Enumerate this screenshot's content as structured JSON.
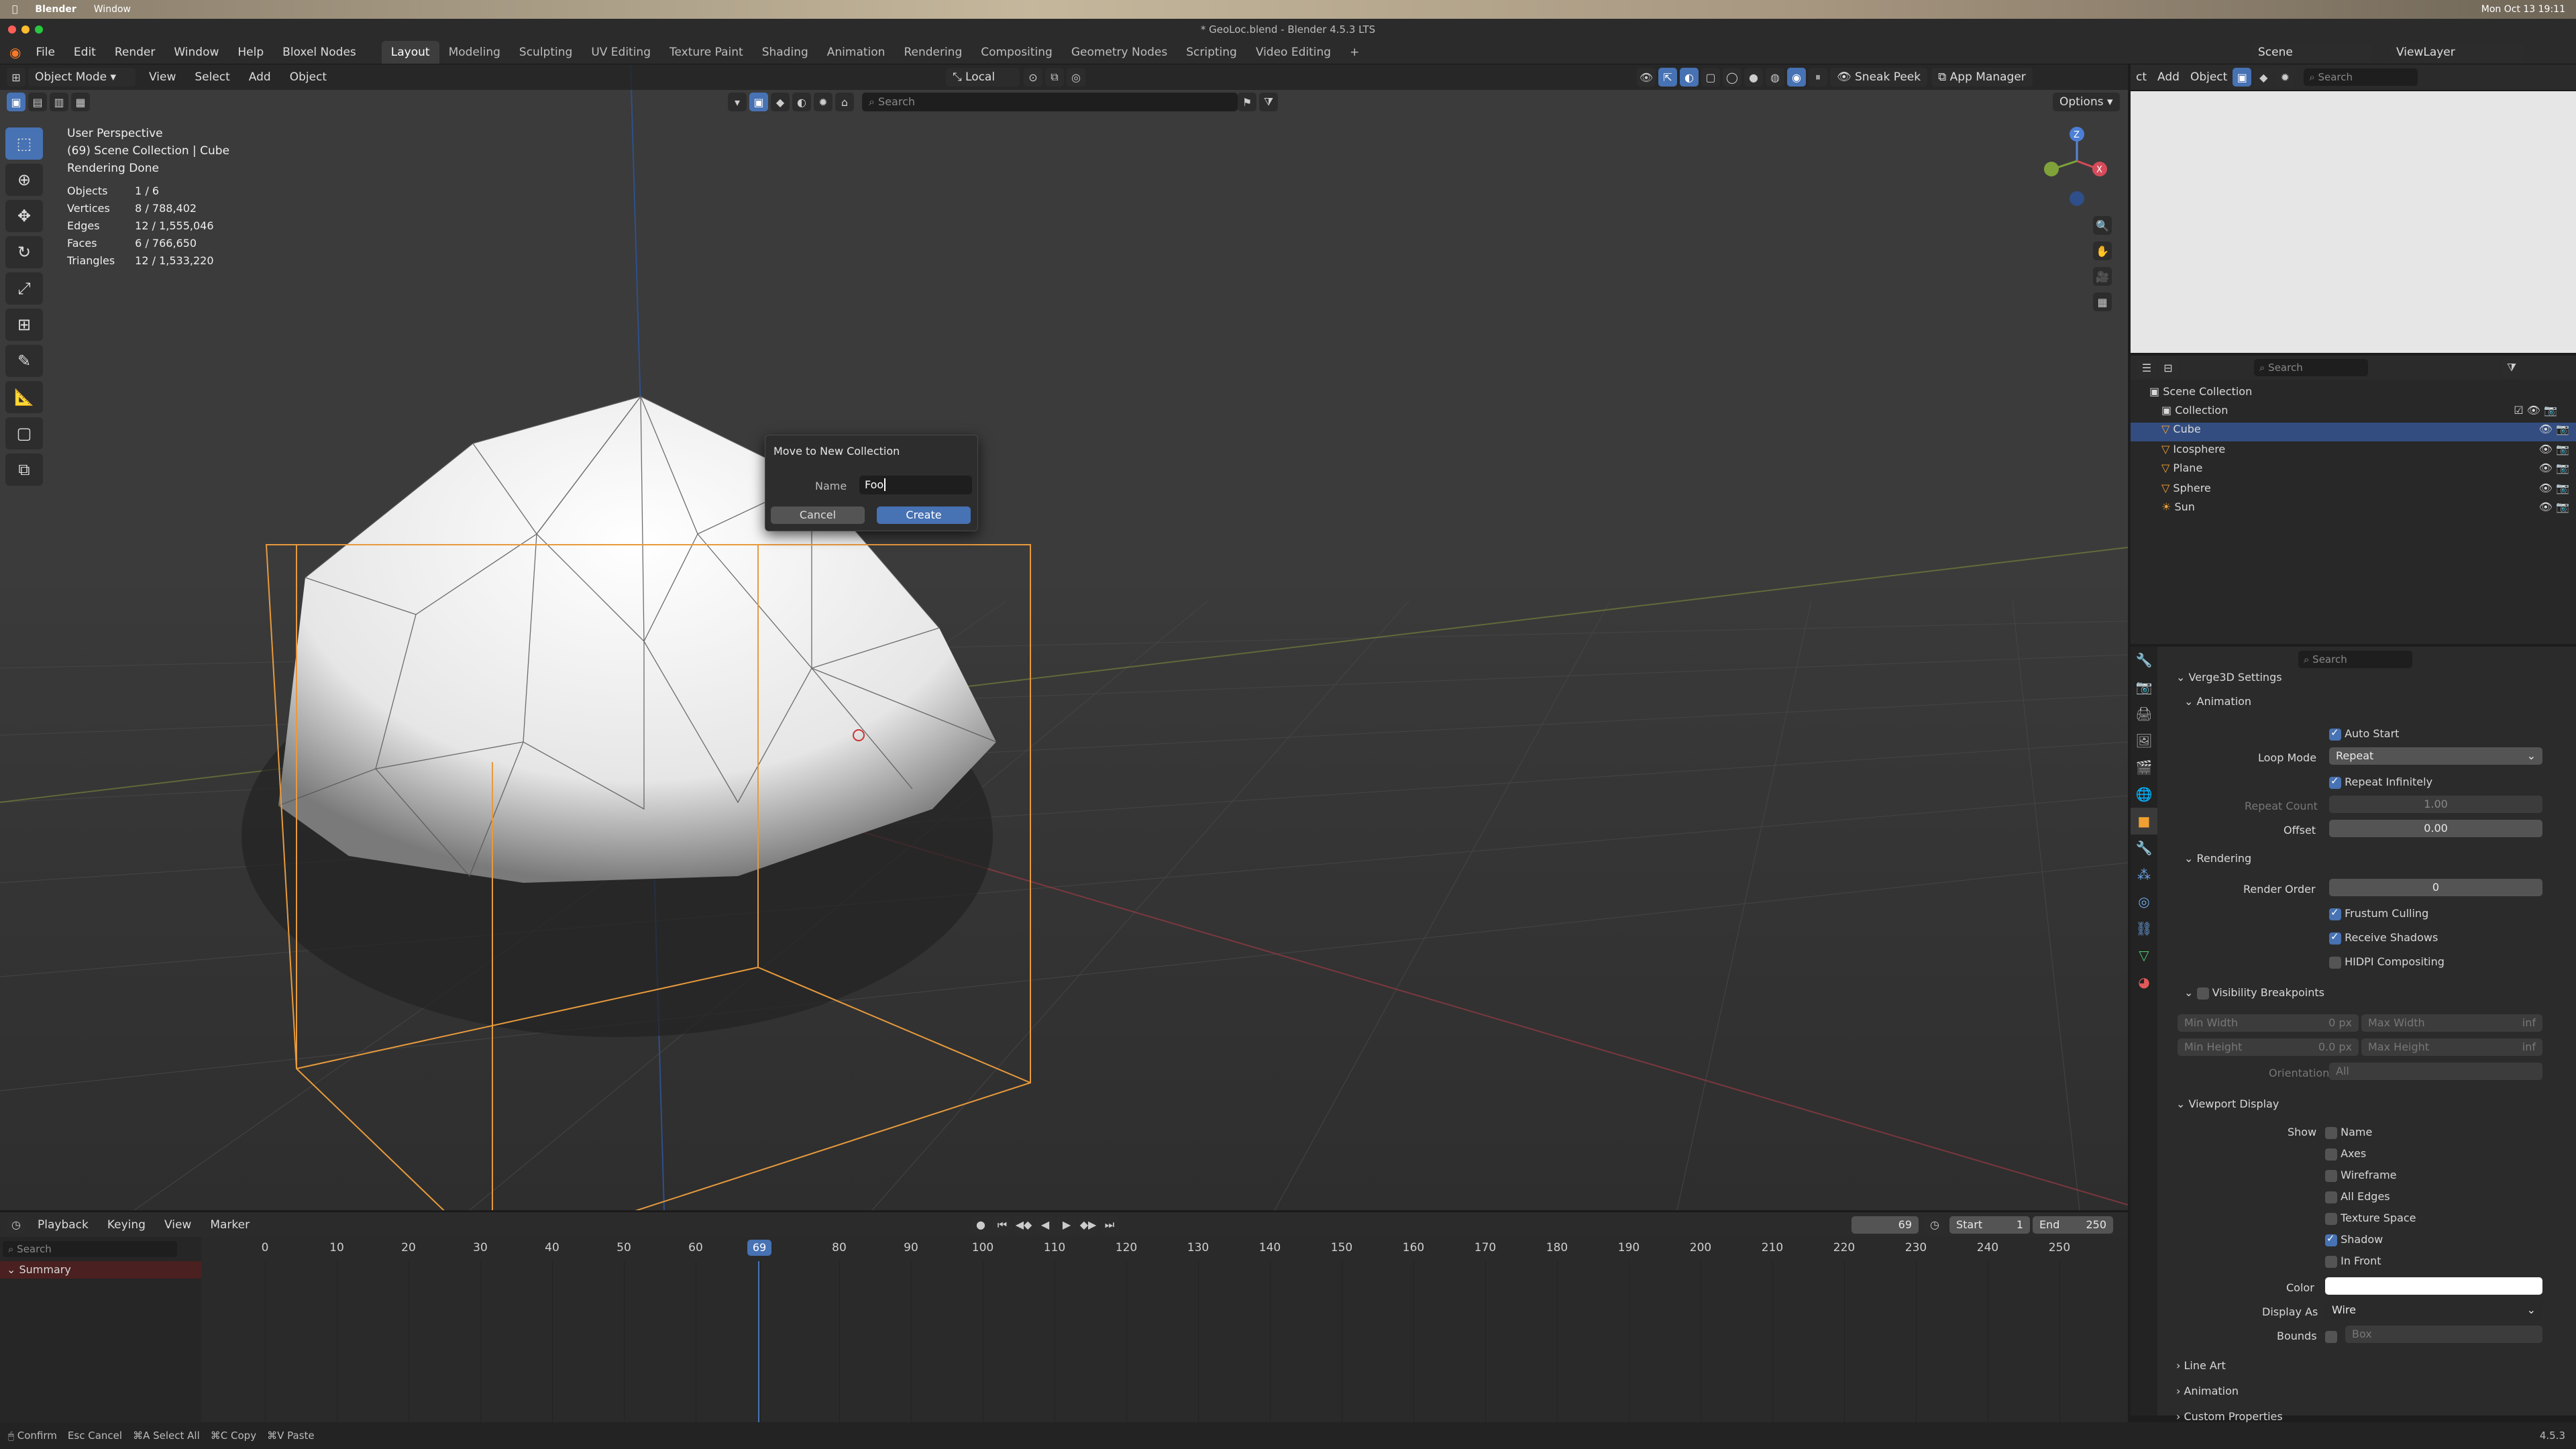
{
  "mac": {
    "app": "Blender",
    "menu": "Window",
    "title": "* GeoLoc.blend - Blender 4.5.3 LTS",
    "datetime": "Mon Oct 13 19:11"
  },
  "menus": [
    "File",
    "Edit",
    "Render",
    "Window",
    "Help",
    "Bloxel Nodes"
  ],
  "workspaces": [
    "Layout",
    "Modeling",
    "Sculpting",
    "UV Editing",
    "Texture Paint",
    "Shading",
    "Animation",
    "Rendering",
    "Compositing",
    "Geometry Nodes",
    "Scripting",
    "Video Editing"
  ],
  "scene_label": "Scene",
  "viewlayer_label": "ViewLayer",
  "vp": {
    "mode": "Object Mode",
    "menus": [
      "View",
      "Select",
      "Add",
      "Object"
    ],
    "transform": "Local",
    "sneak_peek": "Sneak Peek",
    "app_manager": "App Manager",
    "options": "Options",
    "search_placeholder": "Search"
  },
  "stats": {
    "line1": "User Perspective",
    "line2": "(69) Scene Collection | Cube",
    "line3": "Rendering Done",
    "rows": [
      [
        "Objects",
        "1 / 6"
      ],
      [
        "Vertices",
        "8 / 788,402"
      ],
      [
        "Edges",
        "12 / 1,555,046"
      ],
      [
        "Faces",
        "6 / 766,650"
      ],
      [
        "Triangles",
        "12 / 1,533,220"
      ]
    ]
  },
  "dialog": {
    "title": "Move to New Collection",
    "name_label": "Name",
    "name_value": "Foo",
    "cancel": "Cancel",
    "create": "Create"
  },
  "outliner": {
    "search": "Search",
    "header_menus": [
      "ct",
      "Add",
      "Object"
    ],
    "scene_collection": "Scene Collection",
    "collection": "Collection",
    "items": [
      "Cube",
      "Icosphere",
      "Plane",
      "Sphere",
      "Sun"
    ]
  },
  "props": {
    "search": "Search",
    "verge": "Verge3D Settings",
    "animation": "Animation",
    "auto_start": "Auto Start",
    "loop_mode_label": "Loop Mode",
    "loop_mode": "Repeat",
    "repeat_inf": "Repeat Infinitely",
    "repeat_count_label": "Repeat Count",
    "repeat_count": "1.00",
    "offset_label": "Offset",
    "offset": "0.00",
    "rendering": "Rendering",
    "render_order_label": "Render Order",
    "render_order": "0",
    "frustum": "Frustum Culling",
    "receive_shadows": "Receive Shadows",
    "hidpi": "HIDPI Compositing",
    "vis_bp": "Visibility Breakpoints",
    "min_width_label": "Min Width",
    "min_width": "0 px",
    "max_width_label": "Max Width",
    "max_width": "inf",
    "min_height_label": "Min Height",
    "min_height": "0.0 px",
    "max_height_label": "Max Height",
    "max_height": "inf",
    "orientation_label": "Orientation",
    "orientation": "All",
    "viewport_display": "Viewport Display",
    "show_label": "Show",
    "show_items": [
      "Name",
      "Axes",
      "Wireframe",
      "All Edges",
      "Texture Space",
      "Shadow",
      "In Front"
    ],
    "color_label": "Color",
    "display_as_label": "Display As",
    "display_as": "Wire",
    "bounds_label": "Bounds",
    "bounds": "Box",
    "line_art": "Line Art",
    "animation2": "Animation",
    "custom_props": "Custom Properties"
  },
  "timeline": {
    "menus": [
      "Playback",
      "Keying",
      "View",
      "Marker"
    ],
    "current_frame": "69",
    "start_label": "Start",
    "start": "1",
    "end_label": "End",
    "end": "250",
    "search": "Search",
    "summary": "Summary",
    "ticks": [
      "0",
      "10",
      "20",
      "30",
      "40",
      "50",
      "60",
      "69",
      "80",
      "90",
      "100",
      "110",
      "120",
      "130",
      "140",
      "150",
      "160",
      "170",
      "180",
      "190",
      "200",
      "210",
      "220",
      "230",
      "240",
      "250"
    ]
  },
  "status": {
    "confirm": "Confirm",
    "esc": "Esc",
    "cancel": "Cancel",
    "select_all_key": "⌘A",
    "select_all": "Select All",
    "copy_key": "⌘C",
    "copy": "Copy",
    "paste_key": "⌘V",
    "paste": "Paste",
    "version": "4.5.3"
  }
}
